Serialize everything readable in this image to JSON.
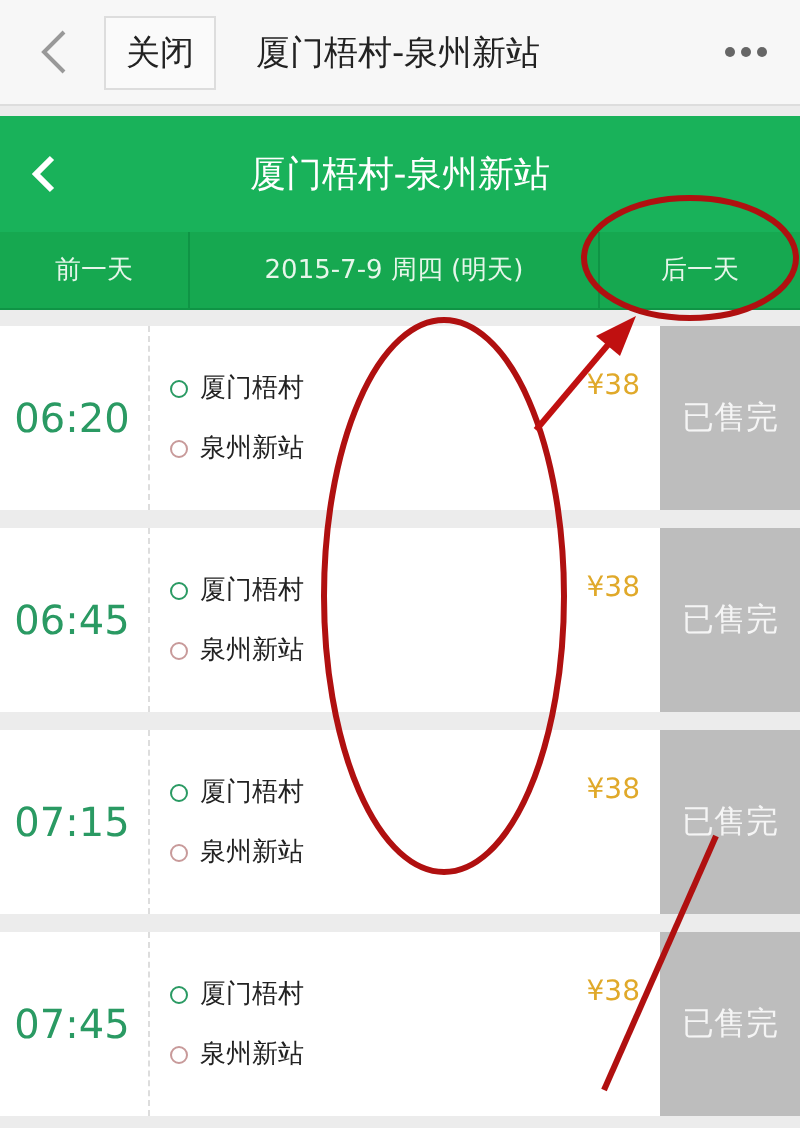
{
  "top_bar": {
    "close_button": "关闭",
    "title": "厦门梧村-泉州新站"
  },
  "header": {
    "title": "厦门梧村-泉州新站"
  },
  "date_bar": {
    "prev": "前一天",
    "date": "2015-7-9 周四 (明天)",
    "next": "后一天"
  },
  "trips": [
    {
      "time": "06:20",
      "from": "厦门梧村",
      "to": "泉州新站",
      "price": "¥38",
      "status": "已售完"
    },
    {
      "time": "06:45",
      "from": "厦门梧村",
      "to": "泉州新站",
      "price": "¥38",
      "status": "已售完"
    },
    {
      "time": "07:15",
      "from": "厦门梧村",
      "to": "泉州新站",
      "price": "¥38",
      "status": "已售完"
    },
    {
      "time": "07:45",
      "from": "厦门梧村",
      "to": "泉州新站",
      "price": "¥38",
      "status": "已售完"
    }
  ]
}
